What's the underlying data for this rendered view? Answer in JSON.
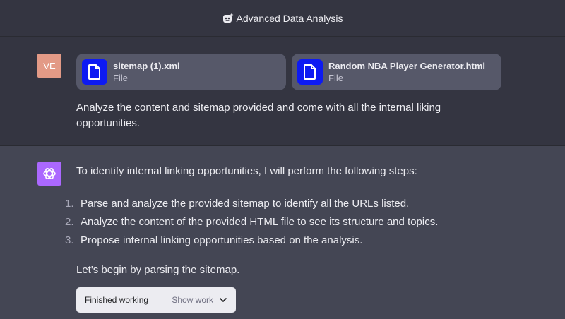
{
  "header": {
    "title": "Advanced Data Analysis",
    "icon": "code-interpreter-icon"
  },
  "user": {
    "avatar_initials": "VE",
    "avatar_color": "#e39a86",
    "files": [
      {
        "name": "sitemap (1).xml",
        "type": "File",
        "icon": "file-icon"
      },
      {
        "name": "Random NBA Player Generator.html",
        "type": "File",
        "icon": "file-icon"
      }
    ],
    "message": "Analyze the content and sitemap provided and come with all the internal liking opportunities."
  },
  "assistant": {
    "avatar_color": "#ab68ff",
    "intro": "To identify internal linking opportunities, I will perform the following steps:",
    "steps": [
      {
        "num": "1.",
        "text": "Parse and analyze the provided sitemap to identify all the URLs listed."
      },
      {
        "num": "2.",
        "text": "Analyze the content of the provided HTML file to see its structure and topics."
      },
      {
        "num": "3.",
        "text": "Propose internal linking opportunities based on the analysis."
      }
    ],
    "begin": "Let's begin by parsing the sitemap.",
    "work": {
      "status": "Finished working",
      "show_label": "Show work"
    }
  }
}
